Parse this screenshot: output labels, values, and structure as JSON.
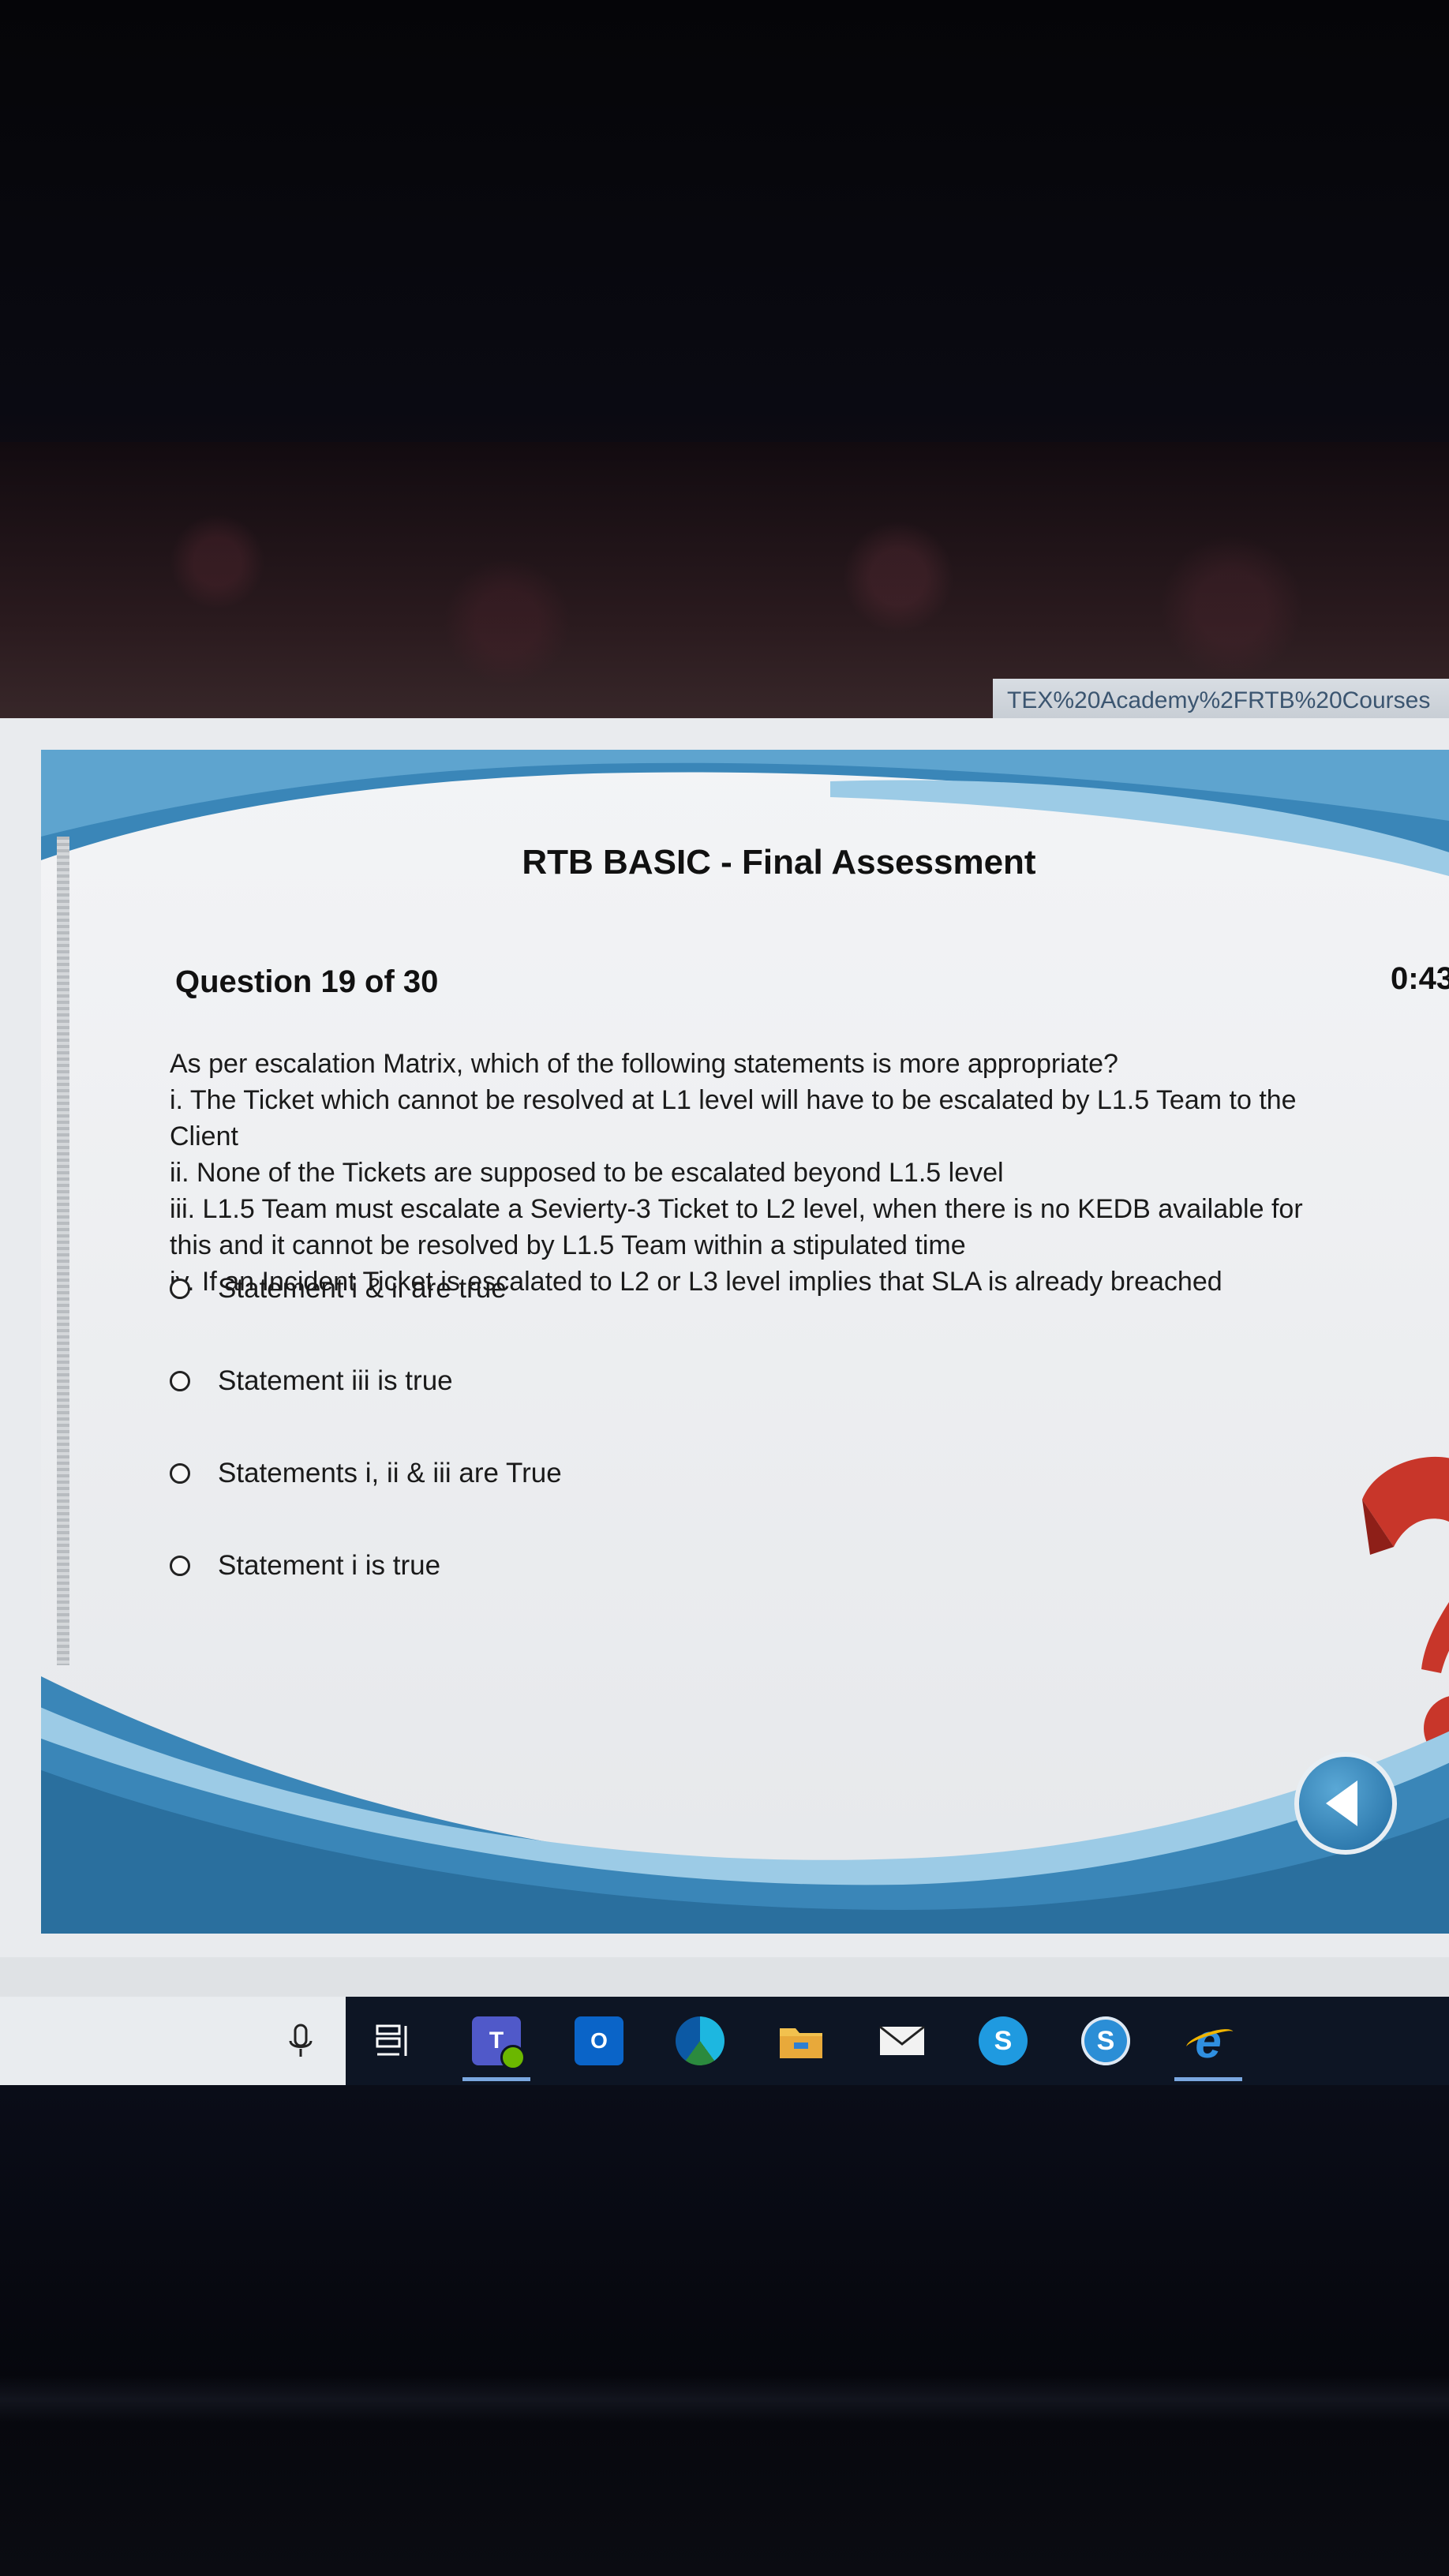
{
  "browser": {
    "url_fragment": "TEX%20Academy%2FRTB%20Courses"
  },
  "slide": {
    "title": "RTB BASIC - Final Assessment",
    "question_number": "Question 19 of 30",
    "timer": "0:43",
    "question_lines": [
      "As per escalation Matrix, which of the following statements is more appropriate?",
      "i. The Ticket which cannot be resolved at L1 level will have to be escalated by L1.5 Team to the",
      "Client",
      "ii. None of the Tickets are supposed to be escalated beyond L1.5 level",
      "iii. L1.5 Team must escalate a Sevierty-3 Ticket to L2 level, when there is no KEDB available for",
      "this and it cannot be resolved by L1.5 Team within a stipulated time",
      "iv. If an Incident Ticket is escalated to L2 or L3 level implies that SLA is already breached"
    ],
    "options": [
      "Statement i & ii are true",
      "Statement iii is true",
      "Statements i, ii & iii are True",
      "Statement i is true"
    ],
    "selected_option": null,
    "back_button_icon": "arrow-left-icon"
  },
  "taskbar": {
    "icons": [
      "microphone-icon",
      "task-view-icon",
      "teams-icon",
      "outlook-icon",
      "edge-icon",
      "file-explorer-icon",
      "mail-icon",
      "skype-icon",
      "skype-for-business-icon",
      "internet-explorer-icon"
    ],
    "labels": {
      "teams": "T",
      "outlook": "O",
      "skype": "S",
      "skype_business": "S",
      "ie": "e"
    },
    "accent_color": "#7aa7e0"
  },
  "colors": {
    "slide_wave_blue": "#3a86b8",
    "slide_wave_light": "#9ccbe6",
    "question_mark_red": "#c8362a"
  }
}
